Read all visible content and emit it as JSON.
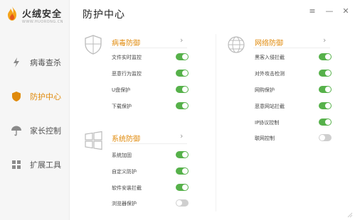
{
  "app": {
    "name": "火绒安全",
    "tagline": "WWW.HUORONG.CN"
  },
  "sidebar": {
    "items": [
      {
        "label": "病毒查杀",
        "icon": "lightning-icon",
        "active": false
      },
      {
        "label": "防护中心",
        "icon": "shield-icon",
        "active": true
      },
      {
        "label": "家长控制",
        "icon": "umbrella-icon",
        "active": false
      },
      {
        "label": "扩展工具",
        "icon": "grid-icon",
        "active": false
      }
    ]
  },
  "header": {
    "title": "防护中心",
    "menu_glyph": "≡",
    "minimize_glyph": "—",
    "close_glyph": "✕"
  },
  "sections": {
    "virus": {
      "title": "病毒防御",
      "icon": "shield-outline-icon",
      "items": [
        {
          "label": "文件实时监控",
          "on": true
        },
        {
          "label": "恶意行为监控",
          "on": true
        },
        {
          "label": "U盘保护",
          "on": true
        },
        {
          "label": "下载保护",
          "on": true
        }
      ]
    },
    "network": {
      "title": "网络防御",
      "icon": "globe-icon",
      "items": [
        {
          "label": "黑客入侵拦截",
          "on": true
        },
        {
          "label": "对外攻击检测",
          "on": true
        },
        {
          "label": "网购保护",
          "on": true
        },
        {
          "label": "恶意网站拦截",
          "on": true
        },
        {
          "label": "IP协议控制",
          "on": true
        },
        {
          "label": "联网控制",
          "on": false
        }
      ]
    },
    "system": {
      "title": "系统防御",
      "icon": "windows-icon",
      "items": [
        {
          "label": "系统加固",
          "on": true
        },
        {
          "label": "自定义防护",
          "on": true
        },
        {
          "label": "软件安装拦截",
          "on": true
        },
        {
          "label": "浏览器保护",
          "on": false
        }
      ]
    }
  },
  "colors": {
    "accent": "#e08a0b",
    "toggle_on": "#56b14a",
    "toggle_off": "#cfcfcf"
  }
}
